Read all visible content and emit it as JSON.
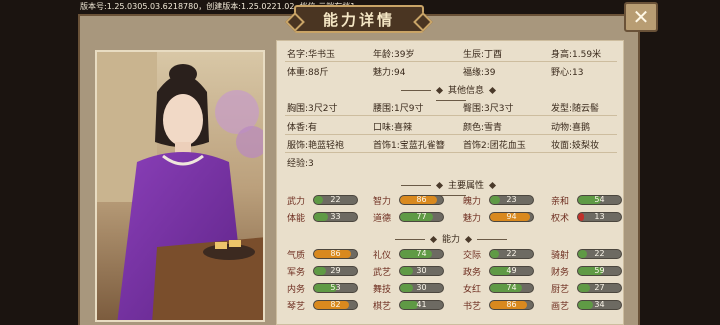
{
  "version_text": "版本号:1.25.0305.03.6218780，创建版本:1.25.0221.02, 档位:云端存档1",
  "title": "能力详情",
  "close_icon": "close-x-icon",
  "basic": [
    [
      {
        "k": "名字:",
        "v": "华书玉"
      },
      {
        "k": "年龄:",
        "v": "39岁"
      },
      {
        "k": "生辰:",
        "v": "丁酉"
      },
      {
        "k": "身高:",
        "v": "1.59米"
      }
    ],
    [
      {
        "k": "体重:",
        "v": "88斤"
      },
      {
        "k": "魅力:",
        "v": "94"
      },
      {
        "k": "福缘:",
        "v": "39"
      },
      {
        "k": "野心:",
        "v": "13"
      }
    ]
  ],
  "other_title": "其他信息",
  "other": [
    [
      {
        "k": "胸围:",
        "v": "3尺2寸"
      },
      {
        "k": "腰围:",
        "v": "1尺9寸"
      },
      {
        "k": "臀围:",
        "v": "3尺3寸"
      },
      {
        "k": "发型:",
        "v": "随云髻"
      }
    ],
    [
      {
        "k": "体香:",
        "v": "有"
      },
      {
        "k": "口味:",
        "v": "喜辣"
      },
      {
        "k": "颜色:",
        "v": "雪青"
      },
      {
        "k": "动物:",
        "v": "喜鹅"
      }
    ],
    [
      {
        "k": "服饰:",
        "v": "艳蓝轻袍"
      },
      {
        "k": "首饰1:",
        "v": "宝蓝孔雀簪"
      },
      {
        "k": "首饰2:",
        "v": "团花血玉"
      },
      {
        "k": "妆面:",
        "v": "妓梨妆"
      }
    ],
    [
      {
        "k": "经验:",
        "v": "3"
      }
    ]
  ],
  "main_title": "主要属性",
  "main_attrs": [
    [
      {
        "k": "武力",
        "v": 22,
        "color": "green"
      },
      {
        "k": "智力",
        "v": 86,
        "color": "orange"
      },
      {
        "k": "魄力",
        "v": 23,
        "color": "green"
      },
      {
        "k": "亲和",
        "v": 54,
        "color": "green"
      }
    ],
    [
      {
        "k": "体能",
        "v": 33,
        "color": "green"
      },
      {
        "k": "道德",
        "v": 77,
        "color": "green"
      },
      {
        "k": "魅力",
        "v": 94,
        "color": "orange"
      },
      {
        "k": "权术",
        "v": 13,
        "color": "red"
      }
    ]
  ],
  "ability_title": "能力",
  "abilities": [
    [
      {
        "k": "气质",
        "v": 86,
        "color": "orange"
      },
      {
        "k": "礼仪",
        "v": 74,
        "color": "green"
      },
      {
        "k": "交际",
        "v": 22,
        "color": "green"
      },
      {
        "k": "骑射",
        "v": 22,
        "color": "green"
      }
    ],
    [
      {
        "k": "军务",
        "v": 29,
        "color": "green"
      },
      {
        "k": "武艺",
        "v": 30,
        "color": "green"
      },
      {
        "k": "政务",
        "v": 49,
        "color": "green"
      },
      {
        "k": "财务",
        "v": 59,
        "color": "green"
      }
    ],
    [
      {
        "k": "内务",
        "v": 53,
        "color": "green"
      },
      {
        "k": "舞技",
        "v": 30,
        "color": "green"
      },
      {
        "k": "女红",
        "v": 74,
        "color": "green"
      },
      {
        "k": "厨艺",
        "v": 27,
        "color": "green"
      }
    ],
    [
      {
        "k": "琴艺",
        "v": 82,
        "color": "orange"
      },
      {
        "k": "棋艺",
        "v": 41,
        "color": "green"
      },
      {
        "k": "书艺",
        "v": 86,
        "color": "orange"
      },
      {
        "k": "画艺",
        "v": 34,
        "color": "green"
      }
    ]
  ],
  "colors": {
    "green": "#5f9a45",
    "orange": "#d9891e",
    "red": "#c0302a"
  }
}
